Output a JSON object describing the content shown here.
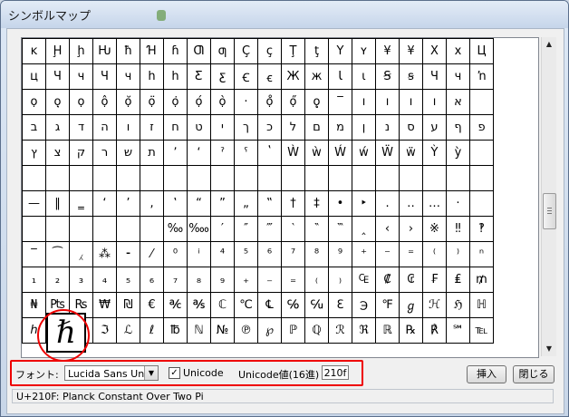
{
  "window": {
    "title": "シンボルマップ"
  },
  "grid": {
    "rows": [
      [
        "ĸ",
        "Ḩ",
        "ḩ",
        "Ƕ",
        "ħ",
        "Ɦ",
        "ɦ",
        "Ƣ",
        "ƣ",
        "Ç",
        "ç",
        "Ţ",
        "ţ",
        "Y",
        "ʏ",
        "¥",
        "¥",
        "X",
        "x",
        "Ц"
      ],
      [
        "ц",
        "Ч",
        "ч",
        "Ч",
        "ч",
        "h",
        "h",
        "Ƹ",
        "ƹ",
        "Ꞓ",
        "ꞓ",
        "Ж",
        "ж",
        "Ɩ",
        "ɩ",
        "Ꞩ",
        "ꞩ",
        "Ч",
        "ч",
        "ŉ"
      ],
      [
        "ọ",
        "ọ̣",
        "ọ",
        "ộ",
        "ọ̆",
        "ọ̈",
        "ọ̇",
        "ọ́",
        "ọ̀",
        "·",
        "ọ̊",
        "ọ̋",
        "ǫ̣",
        "‾",
        "ı",
        "ı",
        "ı",
        "ı",
        "א"
      ],
      [
        "ב",
        "ג",
        "ד",
        "ה",
        "ו",
        "ז",
        "ח",
        "ט",
        "י",
        "ך",
        "כ",
        "ל",
        "ם",
        "מ",
        "ן",
        "נ",
        "ס",
        "ע",
        "ף",
        "פ"
      ],
      [
        "ץ",
        "צ",
        "ק",
        "ר",
        "ש",
        "ת",
        "ʼ",
        "ʻ",
        "ˀ",
        "ˁ",
        "ʽ",
        "Ẁ",
        "ẁ",
        "Ẃ",
        "ẃ",
        "Ẅ",
        "ẅ",
        "Ỳ",
        "ỳ",
        ""
      ],
      [
        "",
        "",
        "",
        "",
        "",
        "",
        "",
        "",
        "",
        "",
        "",
        "",
        "",
        "",
        "",
        "",
        "",
        "",
        "",
        ""
      ],
      [
        "—",
        "‖",
        "‗",
        "‘",
        "’",
        "‚",
        "‛",
        "“",
        "”",
        "„",
        "‟",
        "†",
        "‡",
        "•",
        "‣",
        "․",
        "‥",
        "…",
        "‧",
        ""
      ],
      [
        "",
        "",
        "",
        "",
        "",
        "",
        "‰",
        "‱",
        "′",
        "″",
        "‴",
        "‵",
        "‶",
        "‷",
        "‸",
        "‹",
        "›",
        "※",
        "‼",
        "‽"
      ],
      [
        "‾",
        "⁀",
        "⁁",
        "⁂",
        "⁃",
        "⁄",
        "⁰",
        "ⁱ",
        "⁴",
        "⁵",
        "⁶",
        "⁷",
        "⁸",
        "⁹",
        "⁺",
        "⁻",
        "⁼",
        "⁽",
        "⁾",
        "ⁿ"
      ],
      [
        "₁",
        "₂",
        "₃",
        "₄",
        "₅",
        "₆",
        "₇",
        "₈",
        "₉",
        "₊",
        "₋",
        "₌",
        "₍",
        "₎",
        "₠",
        "₡",
        "₢",
        "₣",
        "₤",
        "₥"
      ],
      [
        "₦",
        "₧",
        "₨",
        "₩",
        "₪",
        "€",
        "℀",
        "℁",
        "ℂ",
        "℃",
        "℄",
        "℅",
        "℆",
        "ℇ",
        "℈",
        "℉",
        "ℊ",
        "ℋ",
        "ℌ",
        "ℍ"
      ],
      [
        "ℎ",
        "ℏ",
        "ℐ",
        "ℑ",
        "ℒ",
        "ℓ",
        "℔",
        "ℕ",
        "№",
        "℗",
        "℘",
        "ℙ",
        "ℚ",
        "ℛ",
        "ℜ",
        "ℝ",
        "℞",
        "℟",
        "℠",
        "℡"
      ]
    ]
  },
  "enlarged": {
    "char": "ℏ"
  },
  "controls": {
    "font_label": "フォント:",
    "font_value": "Lucida Sans Unic",
    "unicode_checkbox_label": "Unicode",
    "unicode_checked": true,
    "unicode_value_label": "Unicode値(16進)",
    "unicode_value": "210f",
    "insert_button": "挿入",
    "close_button": "閉じる"
  },
  "status": {
    "text": "U+210F: Planck Constant Over Two Pi"
  },
  "colors": {
    "highlight_red": "#e00000"
  }
}
